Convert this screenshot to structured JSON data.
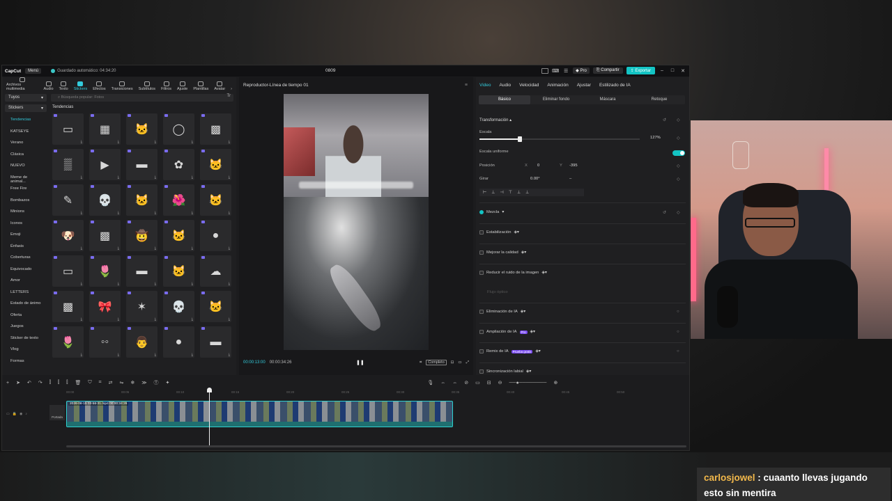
{
  "app": {
    "logo": "CapCut",
    "menu": "Menú",
    "autosave": "Guardado automático: 04:34:20",
    "project_title": "0809",
    "pro": "Pro",
    "share": "Compartir",
    "export": "Exportar"
  },
  "media_tabs": [
    {
      "label": "Archivos multimedia",
      "icon": "media-icon"
    },
    {
      "label": "Audio",
      "icon": "audio-icon"
    },
    {
      "label": "Texto",
      "icon": "text-icon"
    },
    {
      "label": "Stickers",
      "icon": "sticker-icon",
      "active": true
    },
    {
      "label": "Efectos",
      "icon": "effects-icon"
    },
    {
      "label": "Transiciones",
      "icon": "transitions-icon"
    },
    {
      "label": "Subtítulos",
      "icon": "subtitles-icon"
    },
    {
      "label": "Filtros",
      "icon": "filters-icon"
    },
    {
      "label": "Ajuste",
      "icon": "adjust-icon"
    },
    {
      "label": "Plantillas",
      "icon": "templates-icon"
    },
    {
      "label": "Avatar",
      "icon": "avatar-icon"
    }
  ],
  "left": {
    "selector_tuyos": "Tuyos",
    "selector_stickers": "Stickers",
    "categories": [
      "Tendencias",
      "KATSEYE",
      "Verano",
      "Clásica",
      "NUEVO",
      "Meme de animal...",
      "Free Fire",
      "Bombazos",
      "Minions",
      "Iconos",
      "Emoji",
      "Énfasis",
      "Coberturas",
      "Equivocado",
      "Amor",
      "LETTERS",
      "Estado de ánimo",
      "Oferta",
      "Juegos",
      "Sticker de texto",
      "Vlog",
      "Formas"
    ],
    "search_placeholder": "Búsqueda popular: Fotos",
    "filter": "Tr",
    "section": "Tendencias"
  },
  "stickers": [
    "▭",
    "▦",
    "🐱",
    "◯",
    "▩",
    "▒",
    "▶",
    "▬",
    "✿",
    "🐱",
    "✎",
    "💀",
    "🐱",
    "🌺",
    "🐱",
    "🐶",
    "▩",
    "🤠",
    "🐱",
    "●",
    "▭",
    "🌷",
    "▬",
    "🐱",
    "☁",
    "▩",
    "🎀",
    "✶",
    "💀",
    "🐱",
    "🌷",
    "◦◦",
    "👨",
    "●",
    "▬"
  ],
  "player": {
    "title": "Reproductor-Línea de tiempo 01",
    "time_current": "00:00:13:00",
    "time_total": "00:00:34:26",
    "full": "Completo"
  },
  "right": {
    "tabs": [
      "Video",
      "Audio",
      "Velocidad",
      "Animación",
      "Ajustar",
      "Estilizado de IA"
    ],
    "subtabs": [
      "Básico",
      "Eliminar fondo",
      "Máscara",
      "Retoque"
    ],
    "transform": "Transformación",
    "scale_label": "Escala",
    "scale_value": "127%",
    "scale_fraction": 0.127,
    "uniform_scale": "Escala uniforme",
    "position_label": "Posición",
    "pos_x_label": "X",
    "pos_x": "0",
    "pos_y_label": "Y",
    "pos_y": "-395",
    "rotate_label": "Girar",
    "rotate_value": "0.00°",
    "rotate_dash": "–",
    "align_icons": [
      "⊢",
      "⊥",
      "⊣",
      "⊤",
      "⊥",
      "⊥"
    ],
    "blend": "Mezcla",
    "features": [
      "Estabilización",
      "Mejorar la calidad",
      "Reducir el ruido de la imagen"
    ],
    "flow": "Flujo óptico",
    "ai_features": [
      {
        "label": "Eliminación de IA",
        "pill": ""
      },
      {
        "label": "Ampliación de IA",
        "pill": "Pro"
      },
      {
        "label": "Remix de IA",
        "pill": "Prueba gratis"
      },
      {
        "label": "Sincronización labial",
        "pill": ""
      }
    ]
  },
  "timeline": {
    "ruler": [
      "00:00",
      "00:05",
      "00:10",
      "00:15",
      "00:20",
      "00:25",
      "00:30",
      "00:35",
      "00:40",
      "00:45",
      "00:50"
    ],
    "cover": "Portada",
    "clip_label": "2026-08-15 03-56-31.mp4   00:00:34:26"
  },
  "chat": {
    "user": "carlosjowel",
    "message": "cuaanto llevas jugando esto sin mentira"
  }
}
